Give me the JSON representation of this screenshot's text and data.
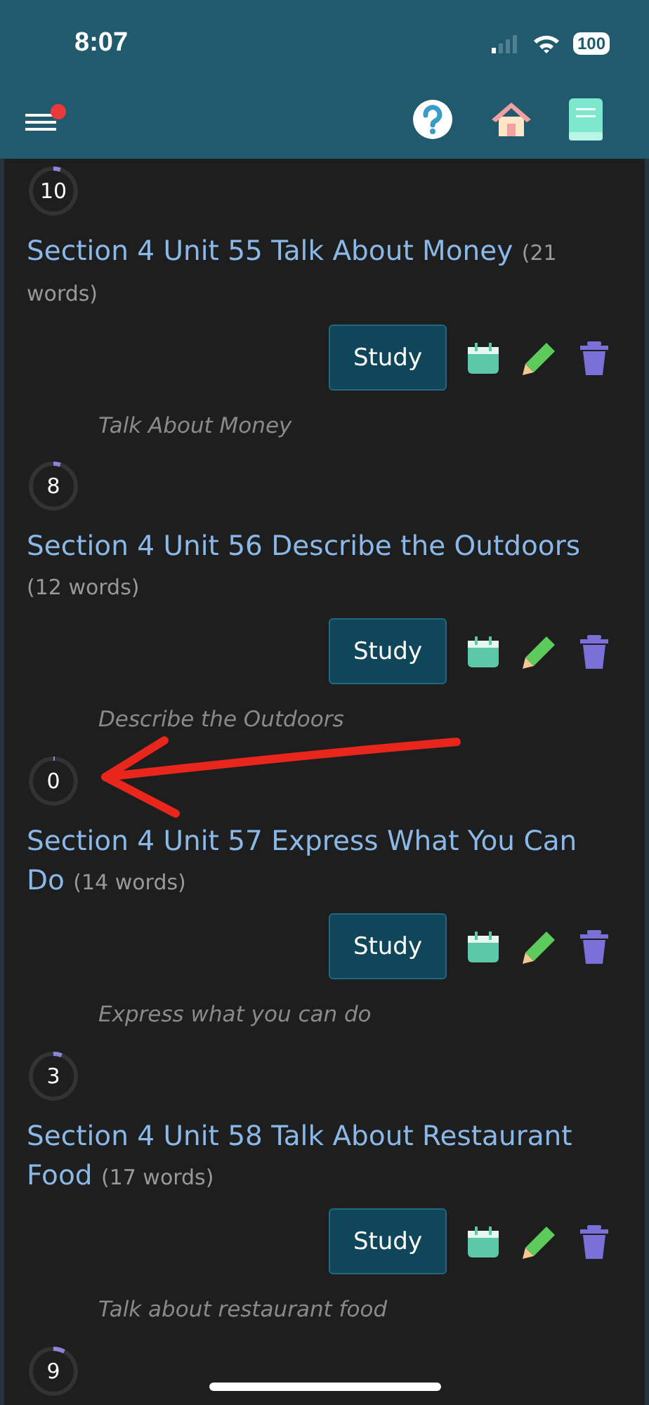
{
  "status_bar": {
    "time": "8:07",
    "battery": "100"
  },
  "header": {
    "menu_badge": true
  },
  "units": [
    {
      "count": "10",
      "level": 0.05,
      "title": "Section 4 Unit 55 Talk About Money",
      "words": "(21 words)",
      "button": "Study",
      "description": "Talk About Money"
    },
    {
      "count": "8",
      "level": 0.05,
      "title": "Section 4 Unit 56 Describe the Outdoors",
      "words": "(12 words)",
      "button": "Study",
      "description": "Describe the Outdoors"
    },
    {
      "count": "0",
      "level": 0.01,
      "annotation_arrow": true,
      "title": "Section 4 Unit 57 Express What You Can Do",
      "words": "(14 words)",
      "button": "Study",
      "description": "Express what you can do"
    },
    {
      "count": "3",
      "level": 0.06,
      "title": "Section 4 Unit 58 Talk About Restaurant Food",
      "words": "(17 words)",
      "button": "Study",
      "description": "Talk about restaurant food"
    },
    {
      "count": "9",
      "level": 0.08
    }
  ]
}
